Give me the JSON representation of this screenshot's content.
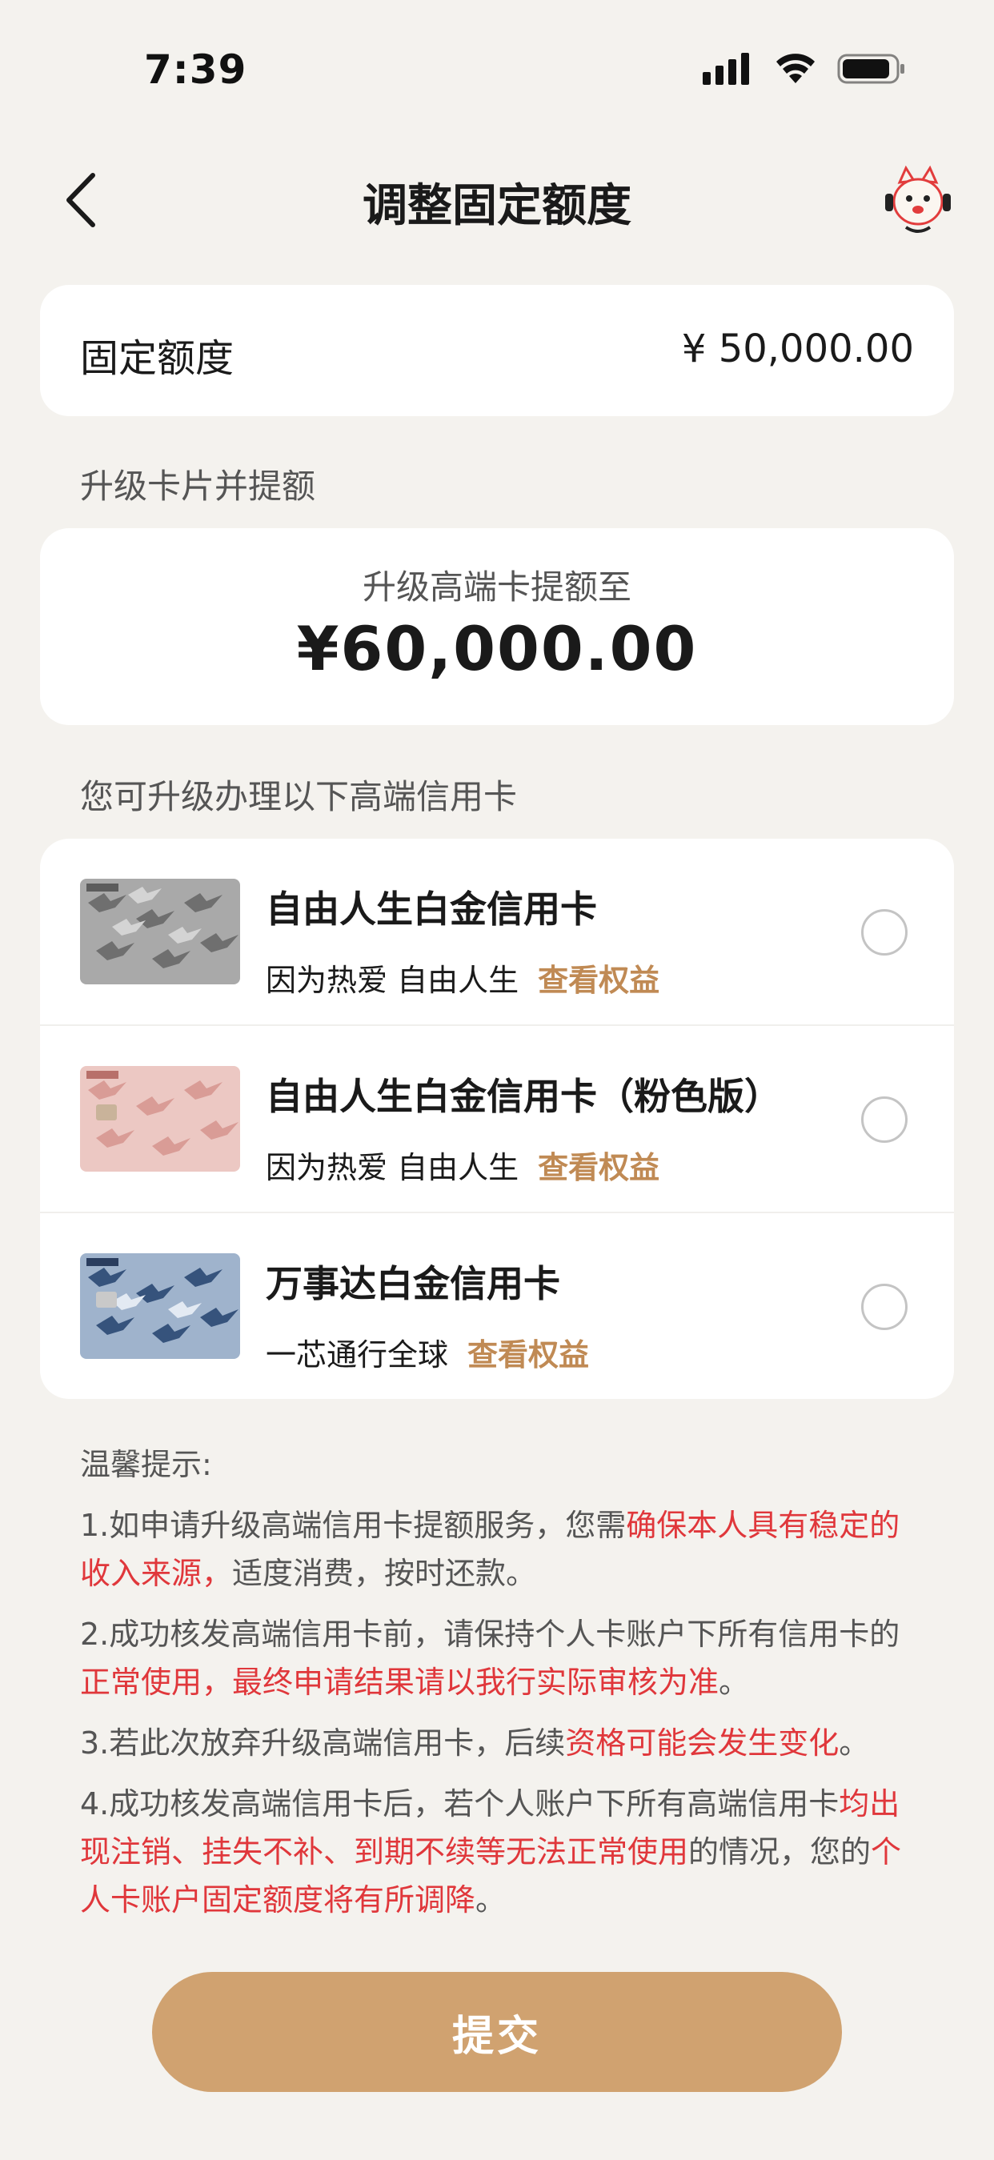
{
  "status_bar": {
    "time": "7:39"
  },
  "nav": {
    "title": "调整固定额度"
  },
  "limit": {
    "label": "固定额度",
    "value": "¥ 50,000.00"
  },
  "upgrade_section_label": "升级卡片并提额",
  "upgrade": {
    "subtitle": "升级高端卡提额至",
    "amount": "¥60,000.00"
  },
  "cards_section_label": "您可升级办理以下高端信用卡",
  "cards": [
    {
      "name": "自由人生白金信用卡",
      "desc": "因为热爱 自由人生",
      "link": "查看权益"
    },
    {
      "name": "自由人生白金信用卡（粉色版）",
      "desc": "因为热爱 自由人生",
      "link": "查看权益"
    },
    {
      "name": "万事达白金信用卡",
      "desc": "一芯通行全球",
      "link": "查看权益"
    }
  ],
  "tips": {
    "title": "温馨提示:",
    "t1_a": "1.如申请升级高端信用卡提额服务，您需",
    "t1_b": "确保本人具有稳定的收入来源，",
    "t1_c": "适度消费，按时还款。",
    "t2_a": "2.成功核发高端信用卡前，请保持个人卡账户下所有信用卡的",
    "t2_b": "正常使用，最终申请结果请以我行实际审核为准",
    "t2_c": "。",
    "t3_a": "3.若此次放弃升级高端信用卡，后续",
    "t3_b": "资格可能会发生变化",
    "t3_c": "。",
    "t4_a": "4.成功核发高端信用卡后，若个人账户下所有高端信用卡",
    "t4_b": "均出现注销、挂失不补、到期不续等无法正常使用",
    "t4_c": "的情况，您的",
    "t4_d": "个人卡账户固定额度将有所调降",
    "t4_e": "。"
  },
  "submit_label": "提交",
  "colors": {
    "accent": "#d0a270",
    "link": "#c08a54",
    "warning": "#e0373b",
    "background": "#f4f2ee"
  }
}
